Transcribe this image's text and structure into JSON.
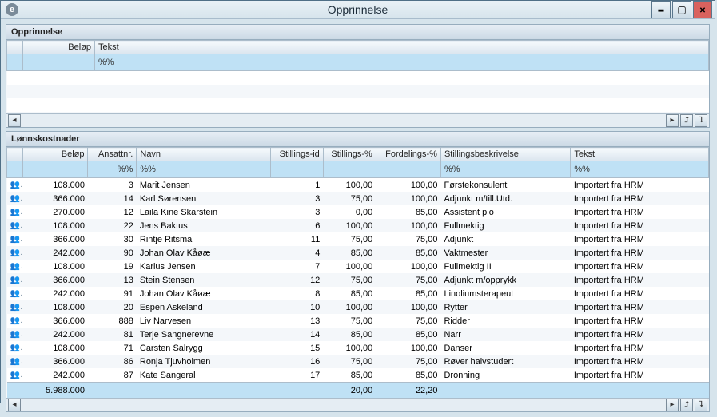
{
  "window": {
    "title": "Opprinnelse"
  },
  "top_panel": {
    "title": "Opprinnelse",
    "headers": {
      "c0": "",
      "belop": "Beløp",
      "tekst": "Tekst"
    },
    "filter": {
      "belop": "",
      "tekst": "%%"
    }
  },
  "bottom_panel": {
    "title": "Lønnskostnader",
    "headers": {
      "c0": "",
      "belop": "Beløp",
      "ansattnr": "Ansattnr.",
      "navn": "Navn",
      "stillingsid": "Stillings-id",
      "stillingspct": "Stillings-%",
      "fordelingspct": "Fordelings-%",
      "stillingsbeskrivelse": "Stillingsbeskrivelse",
      "tekst": "Tekst"
    },
    "filter": {
      "belop": "",
      "ansattnr": "%%",
      "navn": "%%",
      "stillingsid": "",
      "stillingspct": "",
      "fordelingspct": "",
      "stillingsbeskrivelse": "%%",
      "tekst": "%%"
    },
    "rows": [
      {
        "belop": "108.000",
        "ansattnr": "3",
        "navn": "Marit Jensen",
        "stid": "1",
        "stpct": "100,00",
        "fpct": "100,00",
        "stbes": "Førstekonsulent",
        "tekst": "Importert fra HRM"
      },
      {
        "belop": "366.000",
        "ansattnr": "14",
        "navn": "Karl Sørensen",
        "stid": "3",
        "stpct": "75,00",
        "fpct": "100,00",
        "stbes": "Adjunkt m/till.Utd.",
        "tekst": "Importert fra HRM"
      },
      {
        "belop": "270.000",
        "ansattnr": "12",
        "navn": "Laila Kine Skarstein",
        "stid": "3",
        "stpct": "0,00",
        "fpct": "85,00",
        "stbes": "Assistent plo",
        "tekst": "Importert fra HRM"
      },
      {
        "belop": "108.000",
        "ansattnr": "22",
        "navn": "Jens Baktus",
        "stid": "6",
        "stpct": "100,00",
        "fpct": "100,00",
        "stbes": "Fullmektig",
        "tekst": "Importert fra HRM"
      },
      {
        "belop": "366.000",
        "ansattnr": "30",
        "navn": "Rintje Ritsma",
        "stid": "11",
        "stpct": "75,00",
        "fpct": "75,00",
        "stbes": "Adjunkt",
        "tekst": "Importert fra HRM"
      },
      {
        "belop": "242.000",
        "ansattnr": "90",
        "navn": "Johan Olav Kåøæ",
        "stid": "4",
        "stpct": "85,00",
        "fpct": "85,00",
        "stbes": "Vaktmester",
        "tekst": "Importert fra HRM"
      },
      {
        "belop": "108.000",
        "ansattnr": "19",
        "navn": "Karius Jensen",
        "stid": "7",
        "stpct": "100,00",
        "fpct": "100,00",
        "stbes": "Fullmektig II",
        "tekst": "Importert fra HRM"
      },
      {
        "belop": "366.000",
        "ansattnr": "13",
        "navn": "Stein Stensen",
        "stid": "12",
        "stpct": "75,00",
        "fpct": "75,00",
        "stbes": "Adjunkt m/opprykk",
        "tekst": "Importert fra HRM"
      },
      {
        "belop": "242.000",
        "ansattnr": "91",
        "navn": "Johan Olav Kåøæ",
        "stid": "8",
        "stpct": "85,00",
        "fpct": "85,00",
        "stbes": "Linoliumsterapeut",
        "tekst": "Importert fra HRM"
      },
      {
        "belop": "108.000",
        "ansattnr": "20",
        "navn": "Espen Askeland",
        "stid": "10",
        "stpct": "100,00",
        "fpct": "100,00",
        "stbes": "Rytter",
        "tekst": "Importert fra HRM"
      },
      {
        "belop": "366.000",
        "ansattnr": "888",
        "navn": "Liv Narvesen",
        "stid": "13",
        "stpct": "75,00",
        "fpct": "75,00",
        "stbes": "Ridder",
        "tekst": "Importert fra HRM"
      },
      {
        "belop": "242.000",
        "ansattnr": "81",
        "navn": "Terje Sangnerevne",
        "stid": "14",
        "stpct": "85,00",
        "fpct": "85,00",
        "stbes": "Narr",
        "tekst": "Importert fra HRM"
      },
      {
        "belop": "108.000",
        "ansattnr": "71",
        "navn": "Carsten Salrygg",
        "stid": "15",
        "stpct": "100,00",
        "fpct": "100,00",
        "stbes": "Danser",
        "tekst": "Importert fra HRM"
      },
      {
        "belop": "366.000",
        "ansattnr": "86",
        "navn": "Ronja Tjuvholmen",
        "stid": "16",
        "stpct": "75,00",
        "fpct": "75,00",
        "stbes": "Røver halvstudert",
        "tekst": "Importert fra HRM"
      },
      {
        "belop": "242.000",
        "ansattnr": "87",
        "navn": "Kate Sangeral",
        "stid": "17",
        "stpct": "85,00",
        "fpct": "85,00",
        "stbes": "Dronning",
        "tekst": "Importert fra HRM"
      }
    ],
    "sum": {
      "belop": "5.988.000",
      "stpct": "20,00",
      "fpct": "22,20"
    }
  }
}
